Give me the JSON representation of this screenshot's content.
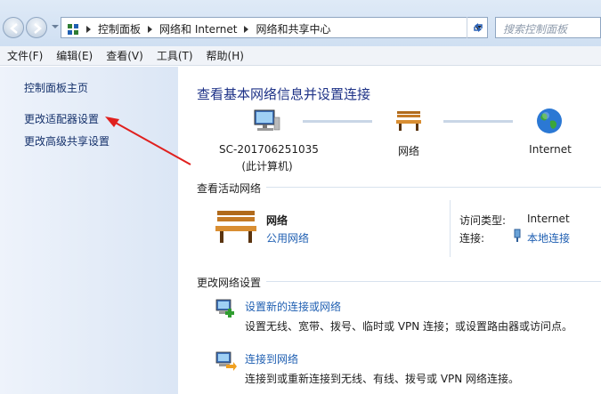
{
  "address_bar": {
    "crumbs": [
      "控制面板",
      "网络和 Internet",
      "网络和共享中心"
    ],
    "search_placeholder": "搜索控制面板"
  },
  "menu": [
    "文件(F)",
    "编辑(E)",
    "查看(V)",
    "工具(T)",
    "帮助(H)"
  ],
  "sidebar": {
    "items": [
      "控制面板主页",
      "更改适配器设置",
      "更改高级共享设置"
    ]
  },
  "main": {
    "title": "查看基本网络信息并设置连接",
    "map": {
      "computer_name": "SC-201706251035",
      "computer_sub": "(此计算机)",
      "network": "网络",
      "internet": "Internet"
    },
    "active_section": "查看活动网络",
    "active": {
      "name": "网络",
      "type": "公用网络",
      "access_label": "访问类型:",
      "access_value": "Internet",
      "conn_label": "连接:",
      "conn_value": "本地连接"
    },
    "change_section": "更改网络设置",
    "tasks": [
      {
        "title": "设置新的连接或网络",
        "desc": "设置无线、宽带、拨号、临时或 VPN 连接；或设置路由器或访问点。"
      },
      {
        "title": "连接到网络",
        "desc": "连接到或重新连接到无线、有线、拨号或 VPN 网络连接。"
      }
    ]
  },
  "colors": {
    "accent": "#1e3287",
    "link": "#1f5fb2",
    "annotation_arrow": "#e0201e"
  }
}
